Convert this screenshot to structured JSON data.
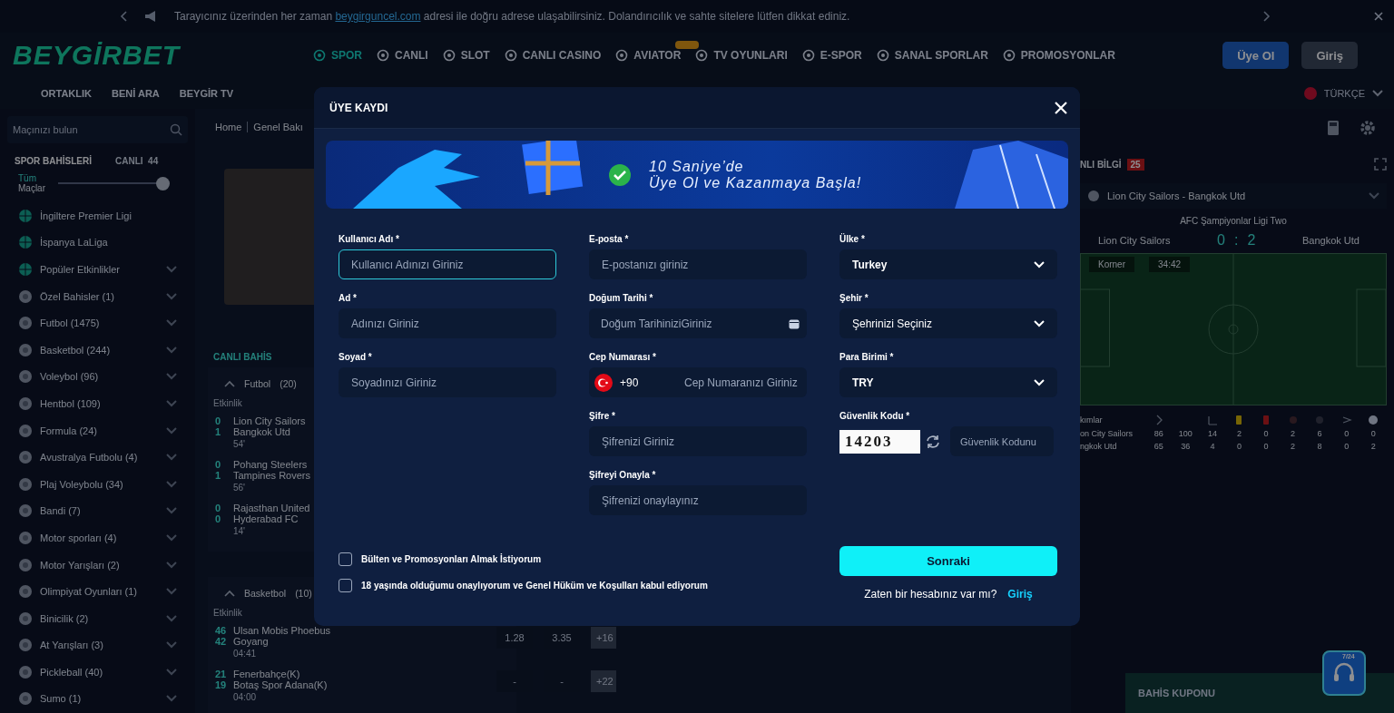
{
  "announcement": {
    "before": "Tarayıcınız üzerinden her zaman ",
    "link": "beygirguncel.com",
    "after": " adresi ile doğru adrese ulaşabilirsiniz. Dolandırıcılık ve sahte sitelere lütfen dikkat ediniz."
  },
  "header": {
    "logo": "BEYGİRBET",
    "nav": [
      {
        "label": "SPOR",
        "selected": true,
        "badge": false
      },
      {
        "label": "CANLI",
        "selected": false,
        "badge": false
      },
      {
        "label": "SLOT",
        "selected": false,
        "badge": false
      },
      {
        "label": "CANLI CASINO",
        "selected": false,
        "badge": false
      },
      {
        "label": "AVIATOR",
        "selected": false,
        "badge": true
      },
      {
        "label": "TV OYUNLARI",
        "selected": false,
        "badge": false
      },
      {
        "label": "E-SPOR",
        "selected": false,
        "badge": false
      },
      {
        "label": "SANAL SPORLAR",
        "selected": false,
        "badge": false
      },
      {
        "label": "PROMOSYONLAR",
        "selected": false,
        "badge": false
      }
    ],
    "buttons": [
      {
        "label": "Üye Ol",
        "kind": "primary"
      },
      {
        "label": "Giriş",
        "kind": "secondary"
      }
    ]
  },
  "subnav": {
    "links": [
      "ORTAKLIK",
      "BENİ ARA",
      "BEYGİR TV"
    ],
    "language": "TÜRKÇE"
  },
  "sidebar": {
    "search": {
      "placeholder": "Maçınızı bulun"
    },
    "tabs": [
      {
        "label": "SPOR BAHİSLERİ",
        "selected": true
      },
      {
        "label": "CANLI",
        "count": "44",
        "selected": false
      }
    ],
    "toggle": {
      "label_1": "Tüm",
      "label_2": "Maçlar",
      "on": true
    },
    "items": [
      {
        "label": "İngiltere Premier Ligi",
        "kind": "featured",
        "expandable": false
      },
      {
        "label": "İspanya LaLiga",
        "kind": "featured",
        "expandable": false
      },
      {
        "label": "Popüler Etkinlikler",
        "kind": "featured",
        "expandable": true
      },
      {
        "label": "Özel Bahisler (1)",
        "kind": "sport",
        "expandable": true
      },
      {
        "label": "Futbol (1475)",
        "kind": "sport",
        "expandable": true
      },
      {
        "label": "Basketbol (244)",
        "kind": "sport",
        "expandable": true
      },
      {
        "label": "Voleybol (96)",
        "kind": "sport",
        "expandable": true
      },
      {
        "label": "Hentbol (109)",
        "kind": "sport",
        "expandable": true
      },
      {
        "label": "Formula (24)",
        "kind": "sport",
        "expandable": true
      },
      {
        "label": "Avustralya Futbolu (4)",
        "kind": "sport",
        "expandable": true
      },
      {
        "label": "Plaj Voleybolu (34)",
        "kind": "sport",
        "expandable": true
      },
      {
        "label": "Bandi (7)",
        "kind": "sport",
        "expandable": true
      },
      {
        "label": "Motor sporları (4)",
        "kind": "sport",
        "expandable": true
      },
      {
        "label": "Motor Yarışları (2)",
        "kind": "sport",
        "expandable": true
      },
      {
        "label": "Olimpiyat Oyunları (1)",
        "kind": "sport",
        "expandable": true
      },
      {
        "label": "Binicilik (2)",
        "kind": "sport",
        "expandable": true
      },
      {
        "label": "At Yarışları (3)",
        "kind": "sport",
        "expandable": true
      },
      {
        "label": "Pickleball (40)",
        "kind": "sport",
        "expandable": true
      },
      {
        "label": "Sumo (1)",
        "kind": "sport",
        "expandable": true
      }
    ]
  },
  "center": {
    "breadcrumb": [
      "Home",
      "Genel Bakı"
    ],
    "live_title": "CANLI BAHİS",
    "sections": [
      {
        "sport": "Futbol",
        "count": "(20)",
        "expanded": true,
        "column": "Etkinlik",
        "matches": [
          {
            "home_score": "0",
            "home": "Lion City Sailors",
            "away_score": "1",
            "away": "Bangkok Utd",
            "time": "54'"
          },
          {
            "home_score": "0",
            "home": "Pohang Steelers",
            "away_score": "1",
            "away": "Tampines Rovers",
            "time": "56'"
          },
          {
            "home_score": "0",
            "home": "Rajasthan United",
            "away_score": "0",
            "away": "Hyderabad FC",
            "time": "14'"
          }
        ]
      },
      {
        "sport": "Basketbol",
        "count": "(10)",
        "expanded": true,
        "column": "Etkinlik",
        "matches": [
          {
            "home_score": "46",
            "home": "Ulsan Mobis Phoebus",
            "away_score": "42",
            "away": "Goyang",
            "time": "04:41",
            "odds": [
              "1.28",
              "3.35"
            ],
            "more": "+16"
          },
          {
            "home_score": "21",
            "home": "Fenerbahçe(K)",
            "away_score": "19",
            "away": "Botaş Spor Adana(K)",
            "time": "04:00",
            "odds": [
              "-",
              "-"
            ],
            "more": "+22"
          }
        ]
      }
    ]
  },
  "live_info": {
    "title": "NLI BİLGİ",
    "count": "25",
    "match_select": "Lion City Sailors - Bangkok Utd",
    "league": "AFC Şampiyonlar Ligi Two",
    "home": "Lion City Sailors",
    "score_home": "0",
    "score_sep": ":",
    "score_away": "2",
    "away": "Bangkok Utd",
    "pitch_event": "Korner",
    "clock": "34:42",
    "stats": {
      "header": "kımlar",
      "rows": [
        {
          "team": "on City Sailors",
          "values": [
            "86",
            "100",
            "14",
            "2",
            "0",
            "2",
            "6",
            "0",
            "0"
          ]
        },
        {
          "team": "ngkok Utd",
          "values": [
            "65",
            "36",
            "4",
            "0",
            "0",
            "2",
            "8",
            "0",
            "2"
          ]
        }
      ]
    }
  },
  "bet_slip": {
    "label": "BAHİS KUPONU"
  },
  "support": {
    "badge": "7/24"
  },
  "modal": {
    "title": "ÜYE KAYDI",
    "banner": {
      "line_1": "10 Saniye’de",
      "line_2": "Üye Ol ve Kazanmaya Başla!"
    },
    "columns": [
      [
        {
          "label": "Kullanıcı Adı *",
          "kind": "text",
          "placeholder": "Kullanıcı Adınızı Giriniz",
          "focused": true
        },
        {
          "label": "Ad *",
          "kind": "text",
          "placeholder": "Adınızı Giriniz",
          "focused": false
        },
        {
          "label": "Soyad *",
          "kind": "text",
          "placeholder": "Soyadınızı Giriniz",
          "focused": false
        }
      ],
      [
        {
          "label": "E-posta *",
          "kind": "text",
          "placeholder": "E-postanızı giriniz",
          "focused": false
        },
        {
          "label": "Doğum Tarihi *",
          "kind": "date",
          "placeholder": "Doğum TarihiniziGiriniz",
          "focused": false
        },
        {
          "label": "Cep Numarası *",
          "kind": "phone",
          "prefix": "+90",
          "placeholder": "Cep Numaranızı Giriniz",
          "focused": false
        },
        {
          "label": "Şifre *",
          "kind": "text",
          "placeholder": "Şifrenizi Giriniz",
          "focused": false
        },
        {
          "label": "Şifreyi Onayla *",
          "kind": "text",
          "placeholder": "Şifrenizi onaylayınız",
          "focused": false
        }
      ],
      [
        {
          "label": "Ülke *",
          "kind": "select",
          "value": "Turkey"
        },
        {
          "label": "Şehir *",
          "kind": "select",
          "value": "Şehrinizi Seçiniz"
        },
        {
          "label": "Para Birimi *",
          "kind": "select",
          "value": "TRY"
        },
        {
          "label": "Güvenlik Kodu *",
          "kind": "captcha",
          "code": "14203",
          "placeholder": "Güvenlik Kodunu",
          "focused": false
        }
      ]
    ],
    "checkboxes": [
      {
        "label": "Bülten ve Promosyonları Almak İstiyorum",
        "checked": false
      },
      {
        "label": "18 yaşında olduğumu onaylıyorum ve Genel Hüküm ve Koşulları kabul ediyorum",
        "checked": false
      }
    ],
    "submit": "Sonraki",
    "login_prompt": "Zaten bir hesabınız var mı?",
    "login_link": "Giriş"
  }
}
